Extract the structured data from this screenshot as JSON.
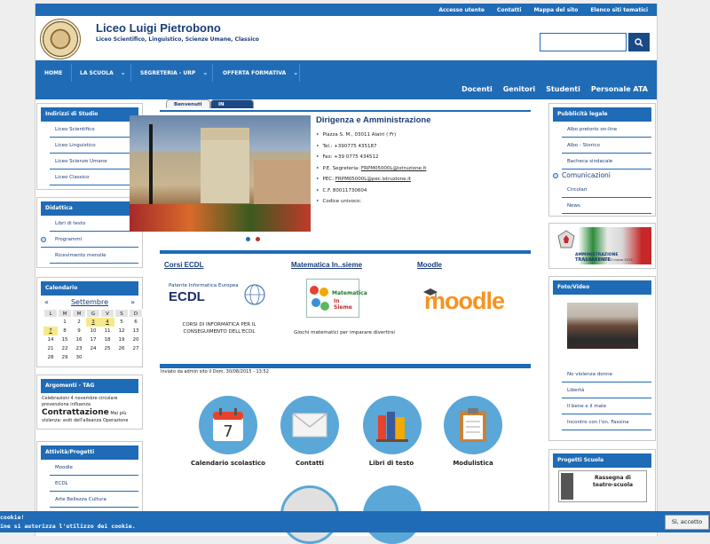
{
  "utility_links": [
    "Accesso utente",
    "Contatti",
    "Mappa del sito",
    "Elenco siti tematici"
  ],
  "site": {
    "title": "Liceo Luigi Pietrobono",
    "subtitle": "Liceo Scientifico, Linguistico, Scienze Umane, Classico"
  },
  "nav": {
    "items": [
      {
        "label": "HOME",
        "has_dropdown": false
      },
      {
        "label": "LA SCUOLA",
        "has_dropdown": true
      },
      {
        "label": "SEGRETERIA - URP",
        "has_dropdown": true
      },
      {
        "label": "OFFERTA FORMATIVA",
        "has_dropdown": true
      }
    ],
    "secondary": [
      "Docenti",
      "Genitori",
      "Studenti",
      "Personale ATA"
    ]
  },
  "left": {
    "indirizzi": {
      "title": "Indirizzi di Studio",
      "items": [
        "Liceo Scientifico",
        "Liceo Linguistico",
        "Liceo Scienze Umane",
        "Liceo Classico"
      ]
    },
    "didattica": {
      "title": "Didattica",
      "items": [
        "Libri di testo",
        "Programmi",
        "Ricevimento mensile"
      ]
    },
    "calendario": {
      "title": "Calendario",
      "prev": "«",
      "month": "Settembre",
      "next": "»",
      "days": [
        "L",
        "M",
        "M",
        "G",
        "V",
        "S",
        "D"
      ],
      "weeks": [
        [
          "",
          "1",
          "2",
          "3",
          "4",
          "5",
          "6"
        ],
        [
          "7",
          "8",
          "9",
          "10",
          "11",
          "12",
          "13"
        ],
        [
          "14",
          "15",
          "16",
          "17",
          "18",
          "19",
          "20"
        ],
        [
          "21",
          "22",
          "23",
          "24",
          "25",
          "26",
          "27"
        ],
        [
          "28",
          "29",
          "30",
          "",
          "",
          "",
          ""
        ]
      ],
      "highlighted": [
        "3",
        "4",
        "7"
      ]
    },
    "argomenti": {
      "title": "Argomenti - TAG",
      "line1": "Celebrazioni 4 novembre circolare prevenzione influenza",
      "big": "Contrattazione",
      "line2": "Mai più violenza: esiti dell'alleanza Operazione"
    },
    "attivita": {
      "title": "Attività/Progetti",
      "items": [
        "Moodle",
        "ECDL",
        "Arte Bellezza Cultura"
      ]
    }
  },
  "center": {
    "tabs": [
      "Benvenuti",
      "IN EVIDENZA"
    ],
    "news_title": "Dirigenza e Amministrazione",
    "info": [
      {
        "text": "Piazza S. M., 03011 Alatri ( Fr)",
        "link": false
      },
      {
        "text": "Tel.: +390775 435187",
        "link": false
      },
      {
        "label": "Fax:",
        "text": "+39 0775 434512",
        "link": false
      },
      {
        "label": "P.E. Segreteria:",
        "text": "FRPM05000L@istruzione.it",
        "link": true
      },
      {
        "label": "PEC:",
        "text": "FRPM05000L@pec.istruzione.it",
        "link": true
      },
      {
        "text": "C.F. 80011730604",
        "link": false
      },
      {
        "text": "Codice univoco:",
        "link": false
      }
    ],
    "columns": [
      {
        "title": "Corsi ECDL",
        "caption1": "CORSI DI INFORMATICA PER IL",
        "caption2": "CONSEGUIMENTO DELL'ECDL",
        "logo_top": "Patente Informatica Europea",
        "logo_main": "ECDL"
      },
      {
        "title": "Matematica In..sieme",
        "caption1": "Giochi matematici per imparare divertirsi",
        "logo_text1": "Matematica",
        "logo_text2": "In Sieme"
      },
      {
        "title": "Moodle",
        "logo_text": "moodle"
      }
    ],
    "posted": "Inviato da admin sito il Dom, 30/08/2015 - 13:52",
    "quick": [
      "Calendario scolastico",
      "Contatti",
      "Libri di testo",
      "Modulistica"
    ],
    "calendar_icon_day": "7"
  },
  "right": {
    "pubblicita": {
      "title": "Pubblicità legale",
      "items": [
        "Albo pretorio on-line",
        "Albo - Storico",
        "Bacheca sindacale"
      ],
      "section": "Comunicazioni",
      "items2": [
        "Circolari",
        "News"
      ]
    },
    "trasparente": {
      "line1": "AMMINISTRAZIONE",
      "line2": "TRASPARENTE",
      "line3": "(D.lgs n. 33 del 14 marzo 2013)"
    },
    "foto": {
      "title": "Foto/Video",
      "items": [
        "No violenza donne",
        "Libertà",
        "Il bene e il male",
        "Incontro con l'on. Fassina"
      ]
    },
    "progetti": {
      "title": "Progetti Scuola",
      "banner1": "Rassegna di",
      "banner2": "teatro-scuola"
    }
  },
  "cookie": {
    "line1": "cookie!",
    "line2": "ine si autorizza l'utilizzo dei cookie.",
    "button": "Sì, accetto"
  },
  "colors": {
    "blue": "#1f6bb6",
    "dark_blue": "#1a3e7a",
    "highlight": "#f7e98a",
    "cookie_bar": "#1f6bb6"
  }
}
